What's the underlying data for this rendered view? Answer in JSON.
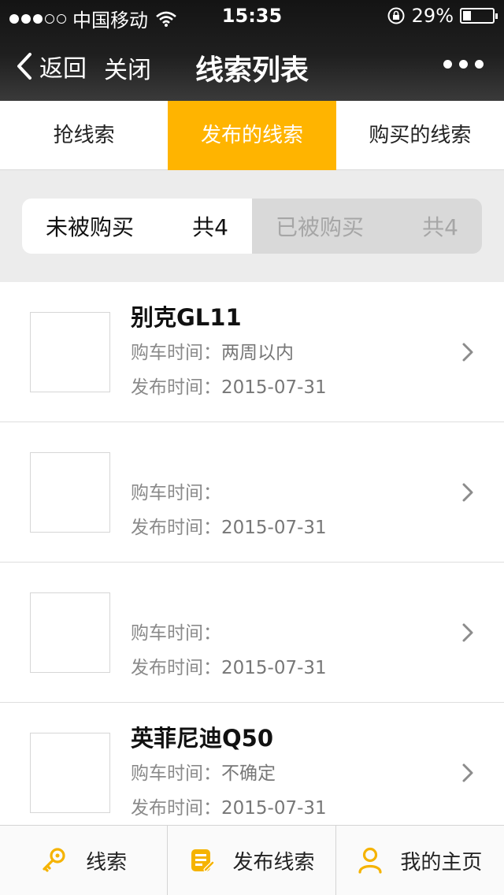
{
  "status_bar": {
    "carrier": "中国移动",
    "time": "15:35",
    "battery": "29%",
    "battery_level": 0.29
  },
  "nav": {
    "back_label": "返回",
    "close_label": "关闭",
    "title": "线索列表"
  },
  "tabs": [
    {
      "label": "抢线索"
    },
    {
      "label": "发布的线索"
    },
    {
      "label": "购买的线索"
    }
  ],
  "segment": {
    "unsold": {
      "label": "未被购买",
      "count": "共4"
    },
    "sold": {
      "label": "已被购买",
      "count": "共4"
    }
  },
  "items": [
    {
      "title": "别克GL11",
      "buy_label": "购车时间：",
      "buy_value": "两周以内",
      "pub_label": "发布时间：",
      "pub_value": "2015-07-31"
    },
    {
      "title": "",
      "buy_label": "购车时间：",
      "buy_value": "",
      "pub_label": "发布时间：",
      "pub_value": "2015-07-31"
    },
    {
      "title": "",
      "buy_label": "购车时间：",
      "buy_value": "",
      "pub_label": "发布时间：",
      "pub_value": "2015-07-31"
    },
    {
      "title": "英菲尼迪Q50",
      "buy_label": "购车时间：",
      "buy_value": "不确定",
      "pub_label": "发布时间：",
      "pub_value": "2015-07-31"
    }
  ],
  "bottom_tabs": [
    {
      "label": "线索",
      "icon": "key-icon"
    },
    {
      "label": "发布线索",
      "icon": "edit-icon"
    },
    {
      "label": "我的主页",
      "icon": "user-icon"
    }
  ],
  "colors": {
    "accent": "#ffb400",
    "nav_bg": "#1f1f1f",
    "segment_off": "#d9d9d9"
  }
}
